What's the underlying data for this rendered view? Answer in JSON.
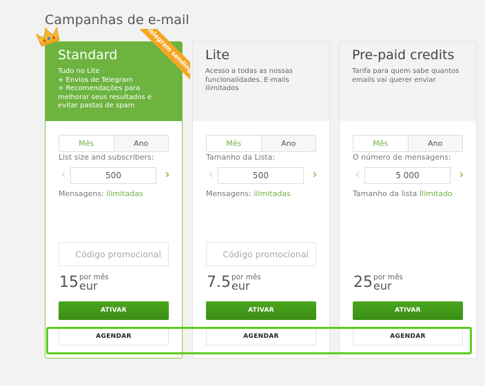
{
  "page": {
    "title": "Campanhas de e-mail"
  },
  "colors": {
    "accent": "#6cb33f",
    "ribbon": "#f5a623",
    "highlight": "#5ecc21"
  },
  "badge": {
    "ribbon_text": "Telegram sendings",
    "icon": "crown-icon"
  },
  "plans": [
    {
      "name": "Standard",
      "description": "Tudo no Lite\n+ Envios de Telegram\n+ Recomendações para melhorar seus resultados e evitar pastas de spam",
      "toggle": {
        "month": "Mês",
        "year": "Ano"
      },
      "quantity_label": "List size and subscribers:",
      "quantity_value": "500",
      "messages_label": "Mensagens: ",
      "messages_value": "ilimitadas",
      "promo_placeholder": "Código promocional",
      "price": "15",
      "price_period": "por mês",
      "currency": "eur",
      "activate_label": "ATIVAR",
      "schedule_label": "AGENDAR"
    },
    {
      "name": "Lite",
      "description": "Acesso a todas as nossas funcionalidades. E-mails ilimitados",
      "toggle": {
        "month": "Mês",
        "year": "Ano"
      },
      "quantity_label": "Tamanho da Lista:",
      "quantity_value": "500",
      "messages_label": "Mensagens: ",
      "messages_value": "ilimitadas",
      "promo_placeholder": "Código promocional",
      "price": "7.5",
      "price_period": "por mês",
      "currency": "eur",
      "activate_label": "ATIVAR",
      "schedule_label": "AGENDAR"
    },
    {
      "name": "Pre-paid credits",
      "description": "Tarifa para quem sabe quantos emails vai querer enviar",
      "toggle": {
        "month": "Mês",
        "year": "Ano"
      },
      "quantity_label": "O número de mensagens:",
      "quantity_value": "5 000",
      "messages_label": "Tamanho da lista ",
      "messages_value": "Ilimitado",
      "price": "25",
      "price_period": "por mês",
      "currency": "eur",
      "activate_label": "ATIVAR",
      "schedule_label": "AGENDAR"
    }
  ]
}
